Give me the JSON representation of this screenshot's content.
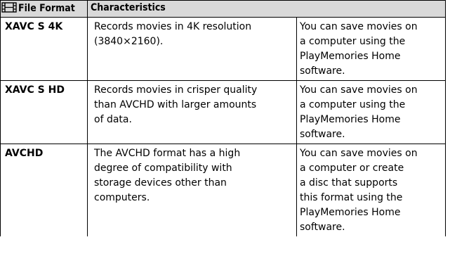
{
  "table": {
    "headers": {
      "format_icon": "film-icon",
      "format": "File Format",
      "characteristics": "Characteristics"
    },
    "rows": [
      {
        "format": "XAVC S 4K",
        "description": "Records movies in 4K resolution\n(3840×2160).",
        "note": "You can save movies on\na computer using the\nPlayMemories Home\nsoftware."
      },
      {
        "format": "XAVC S HD",
        "description": "Records movies in crisper quality\nthan AVCHD with larger amounts\nof data.",
        "note": "You can save movies on\na computer using the\nPlayMemories Home\nsoftware."
      },
      {
        "format": "AVCHD",
        "description": "The AVCHD format has a high\ndegree of compatibility with\nstorage devices other than\ncomputers.",
        "note": "You can save movies on\na computer or create\na disc that supports\nthis format using the\nPlayMemories Home\nsoftware."
      }
    ]
  },
  "colors": {
    "header_background": "#d9d9d9",
    "border": "#000000",
    "text": "#000000",
    "background": "#ffffff"
  }
}
